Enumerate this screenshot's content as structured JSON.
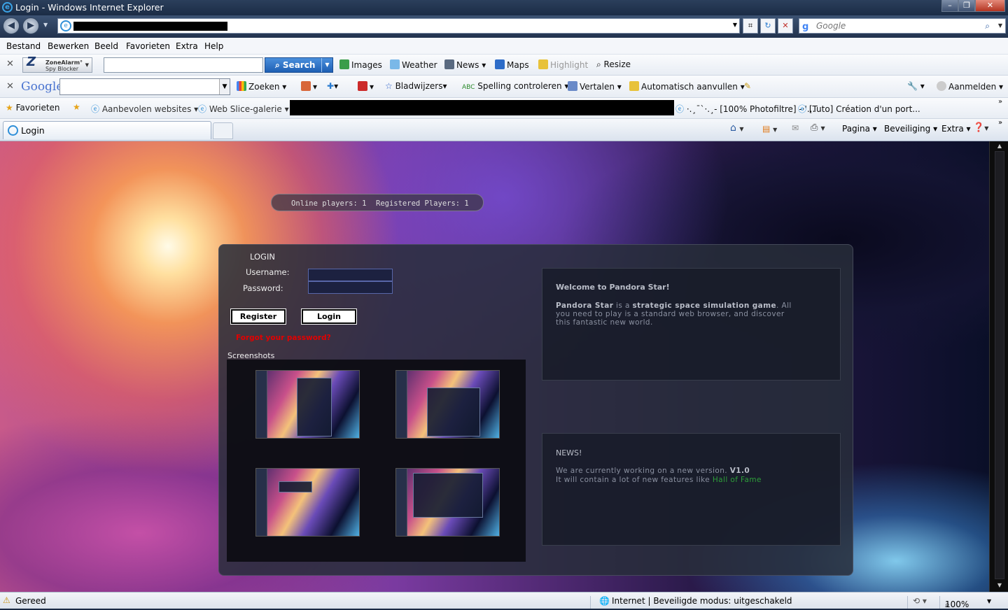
{
  "window": {
    "title": "Login - Windows Internet Explorer"
  },
  "search_provider": {
    "placeholder": "Google"
  },
  "menu": [
    "Bestand",
    "Bewerken",
    "Beeld",
    "Favorieten",
    "Extra",
    "Help"
  ],
  "zonealarm": {
    "brand_line1": "ZoneAlarm°",
    "brand_line2": "Spy Blocker",
    "search_label": "Search",
    "items": [
      "Images",
      "Weather",
      "News",
      "Maps",
      "Highlight",
      "Resize"
    ]
  },
  "google_toolbar": {
    "logo": "Google",
    "search_label": "Zoeken",
    "bookmarks_label": "Bladwijzers",
    "spell_label": "Spelling controleren",
    "translate_label": "Vertalen",
    "autofill_label": "Automatisch aanvullen",
    "signin_label": "Aanmelden"
  },
  "favorites_bar": {
    "favorites_label": "Favorieten",
    "suggested_label": "Aanbevolen websites",
    "slice_label": "Web Slice-galerie",
    "link1": "·.¸¯`·.¸- [100% Photofiltre] -·'...",
    "link2": "[Tuto] Création d'un port..."
  },
  "tabs": {
    "active_label": "Login"
  },
  "command_bar": {
    "page_label": "Pagina",
    "safety_label": "Beveiliging",
    "tools_label": "Extra"
  },
  "page": {
    "stats": {
      "online": "Online players: 1",
      "registered": "Registered Players: 1"
    },
    "login": {
      "heading": "LOGIN",
      "username_label": "Username:",
      "password_label": "Password:",
      "register_button": "Register",
      "login_button": "Login",
      "forgot_link": "Forgot your password?",
      "screenshots_heading": "Screenshots"
    },
    "welcome": {
      "title": "Welcome to Pandora Star!",
      "text_bold1": "Pandora Star",
      "text_mid1": " is a ",
      "text_bold2": "strategic space simulation game",
      "text_rest": ". All you need to play is a standard web browser, and discover this fantastic new world."
    },
    "news": {
      "title": "NEWS!",
      "line1_text": "We are currently working on a new version. ",
      "line1_version": "V1.0",
      "line2_text": "It will contain a lot of new features like ",
      "line2_link": "Hall of Fame"
    }
  },
  "status": {
    "left": "Gereed",
    "zone": "Internet | Beveiligde modus: uitgeschakeld",
    "zoom": "100%"
  },
  "colors": {
    "forgot_link": "#e20000",
    "hall_of_fame": "#2e9e3a"
  }
}
